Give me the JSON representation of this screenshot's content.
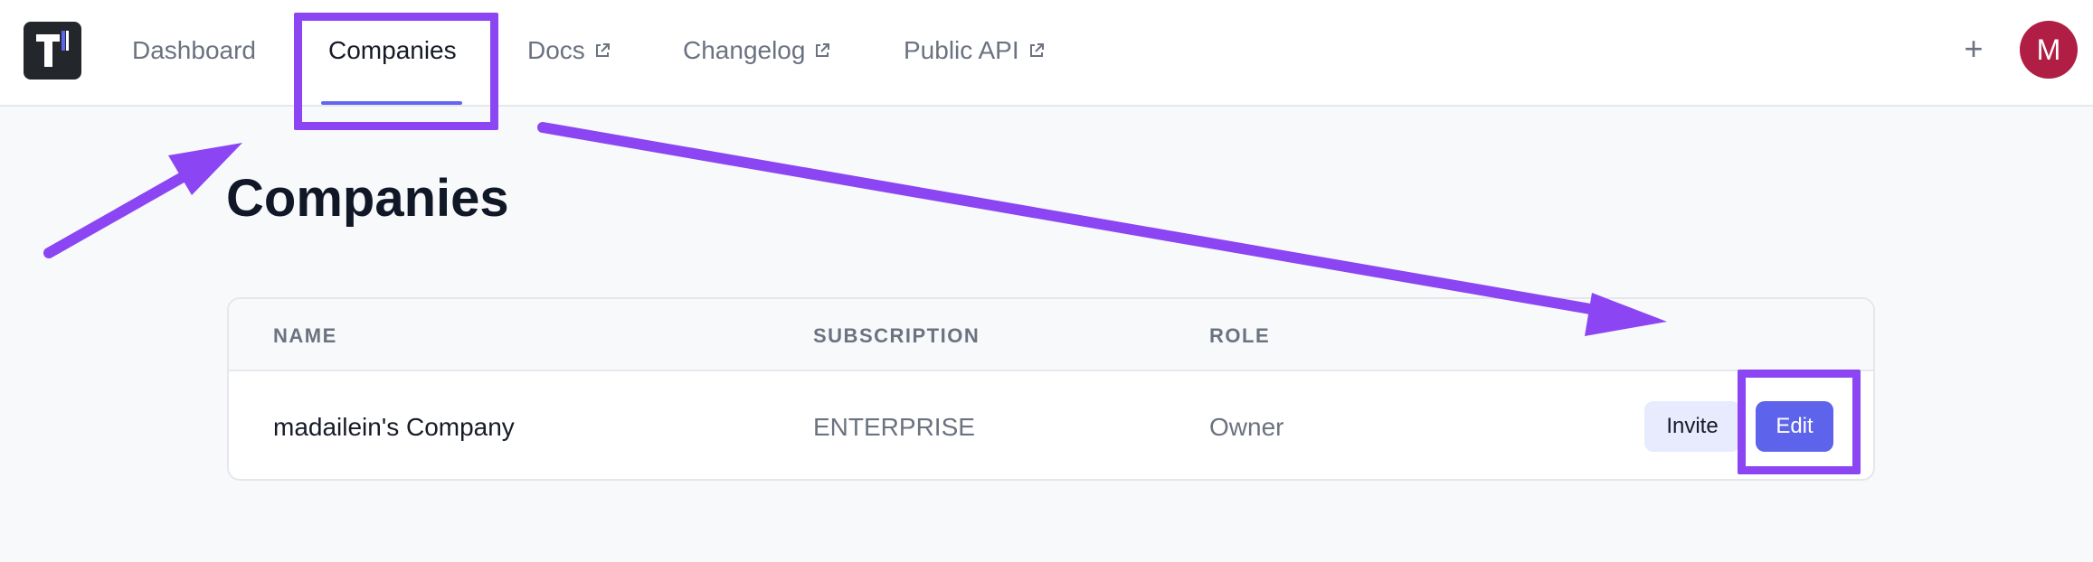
{
  "nav": {
    "items": [
      {
        "label": "Dashboard",
        "external": false
      },
      {
        "label": "Companies",
        "external": false,
        "active": true
      },
      {
        "label": "Docs",
        "external": true
      },
      {
        "label": "Changelog",
        "external": true
      },
      {
        "label": "Public API",
        "external": true
      }
    ],
    "plus_label": "+",
    "avatar_initial": "M"
  },
  "page": {
    "title": "Companies"
  },
  "table": {
    "columns": [
      "NAME",
      "SUBSCRIPTION",
      "ROLE"
    ],
    "rows": [
      {
        "name": "madailein's Company",
        "subscription": "ENTERPRISE",
        "role": "Owner",
        "actions": [
          "Invite",
          "Edit"
        ]
      }
    ]
  },
  "colors": {
    "accent": "#6366f1",
    "edit_button": "#5d63ea",
    "avatar": "#b01e45",
    "annotation": "#8b45f3"
  },
  "icons": [
    "logo-icon",
    "external-link-icon",
    "plus-icon"
  ]
}
